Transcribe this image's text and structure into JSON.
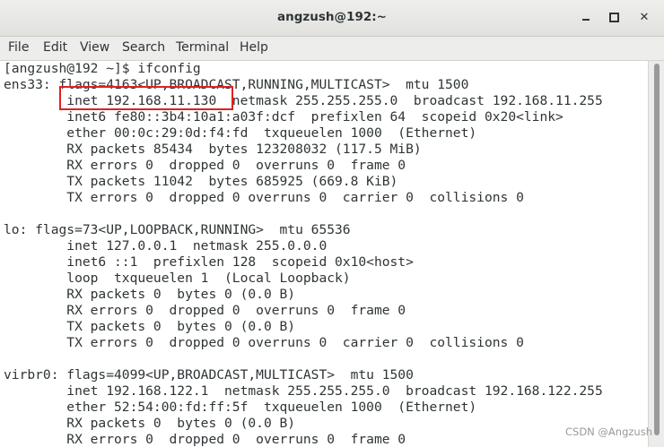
{
  "window": {
    "title": "angzush@192:~",
    "minimize_icon": "minimize-icon",
    "maximize_icon": "maximize-icon",
    "close_glyph": "✕"
  },
  "menu": [
    "File",
    "Edit",
    "View",
    "Search",
    "Terminal",
    "Help"
  ],
  "terminal": {
    "lines": [
      "[angzush@192 ~]$ ifconfig",
      "ens33: flags=4163<UP,BROADCAST,RUNNING,MULTICAST>  mtu 1500",
      "        inet 192.168.11.130  netmask 255.255.255.0  broadcast 192.168.11.255",
      "        inet6 fe80::3b4:10a1:a03f:dcf  prefixlen 64  scopeid 0x20<link>",
      "        ether 00:0c:29:0d:f4:fd  txqueuelen 1000  (Ethernet)",
      "        RX packets 85434  bytes 123208032 (117.5 MiB)",
      "        RX errors 0  dropped 0  overruns 0  frame 0",
      "        TX packets 11042  bytes 685925 (669.8 KiB)",
      "        TX errors 0  dropped 0 overruns 0  carrier 0  collisions 0",
      "",
      "lo: flags=73<UP,LOOPBACK,RUNNING>  mtu 65536",
      "        inet 127.0.0.1  netmask 255.0.0.0",
      "        inet6 ::1  prefixlen 128  scopeid 0x10<host>",
      "        loop  txqueuelen 1  (Local Loopback)",
      "        RX packets 0  bytes 0 (0.0 B)",
      "        RX errors 0  dropped 0  overruns 0  frame 0",
      "        TX packets 0  bytes 0 (0.0 B)",
      "        TX errors 0  dropped 0 overruns 0  carrier 0  collisions 0",
      "",
      "virbr0: flags=4099<UP,BROADCAST,MULTICAST>  mtu 1500",
      "        inet 192.168.122.1  netmask 255.255.255.0  broadcast 192.168.122.255",
      "        ether 52:54:00:fd:ff:5f  txqueuelen 1000  (Ethernet)",
      "        RX packets 0  bytes 0 (0.0 B)",
      "        RX errors 0  dropped 0  overruns 0  frame 0"
    ]
  },
  "annotation": {
    "color": "#e02020"
  },
  "watermark": "CSDN @Angzush"
}
